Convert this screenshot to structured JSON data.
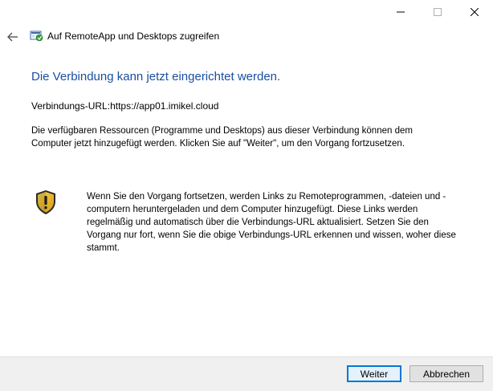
{
  "window": {
    "minimize_icon": "minimize-icon",
    "maximize_icon": "maximize-icon",
    "close_icon": "close-icon"
  },
  "header": {
    "back_icon": "back-arrow-icon",
    "app_icon": "remoteapp-icon",
    "title": "Auf RemoteApp und Desktops zugreifen"
  },
  "main": {
    "heading": "Die Verbindung kann jetzt eingerichtet werden.",
    "url_label": "Verbindungs-URL:",
    "url_value": "https://app01.imikel.cloud",
    "description": "Die verfügbaren Ressourcen (Programme und Desktops) aus dieser Verbindung können dem Computer jetzt hinzugefügt werden. Klicken Sie auf \"Weiter\", um den Vorgang fortzusetzen.",
    "warning_icon": "security-shield-icon",
    "warning_text": "Wenn Sie den Vorgang fortsetzen, werden Links zu Remoteprogrammen, -dateien und -computern heruntergeladen und dem Computer hinzugefügt. Diese Links werden regelmäßig und automatisch über die Verbindungs-URL aktualisiert. Setzen Sie den Vorgang nur fort, wenn Sie die obige Verbindungs-URL erkennen und wissen, woher diese stammt."
  },
  "footer": {
    "next_label": "Weiter",
    "cancel_label": "Abbrechen"
  },
  "colors": {
    "heading": "#1a4fa0",
    "focus_border": "#0078d7",
    "footer_bg": "#f0f0f0"
  }
}
